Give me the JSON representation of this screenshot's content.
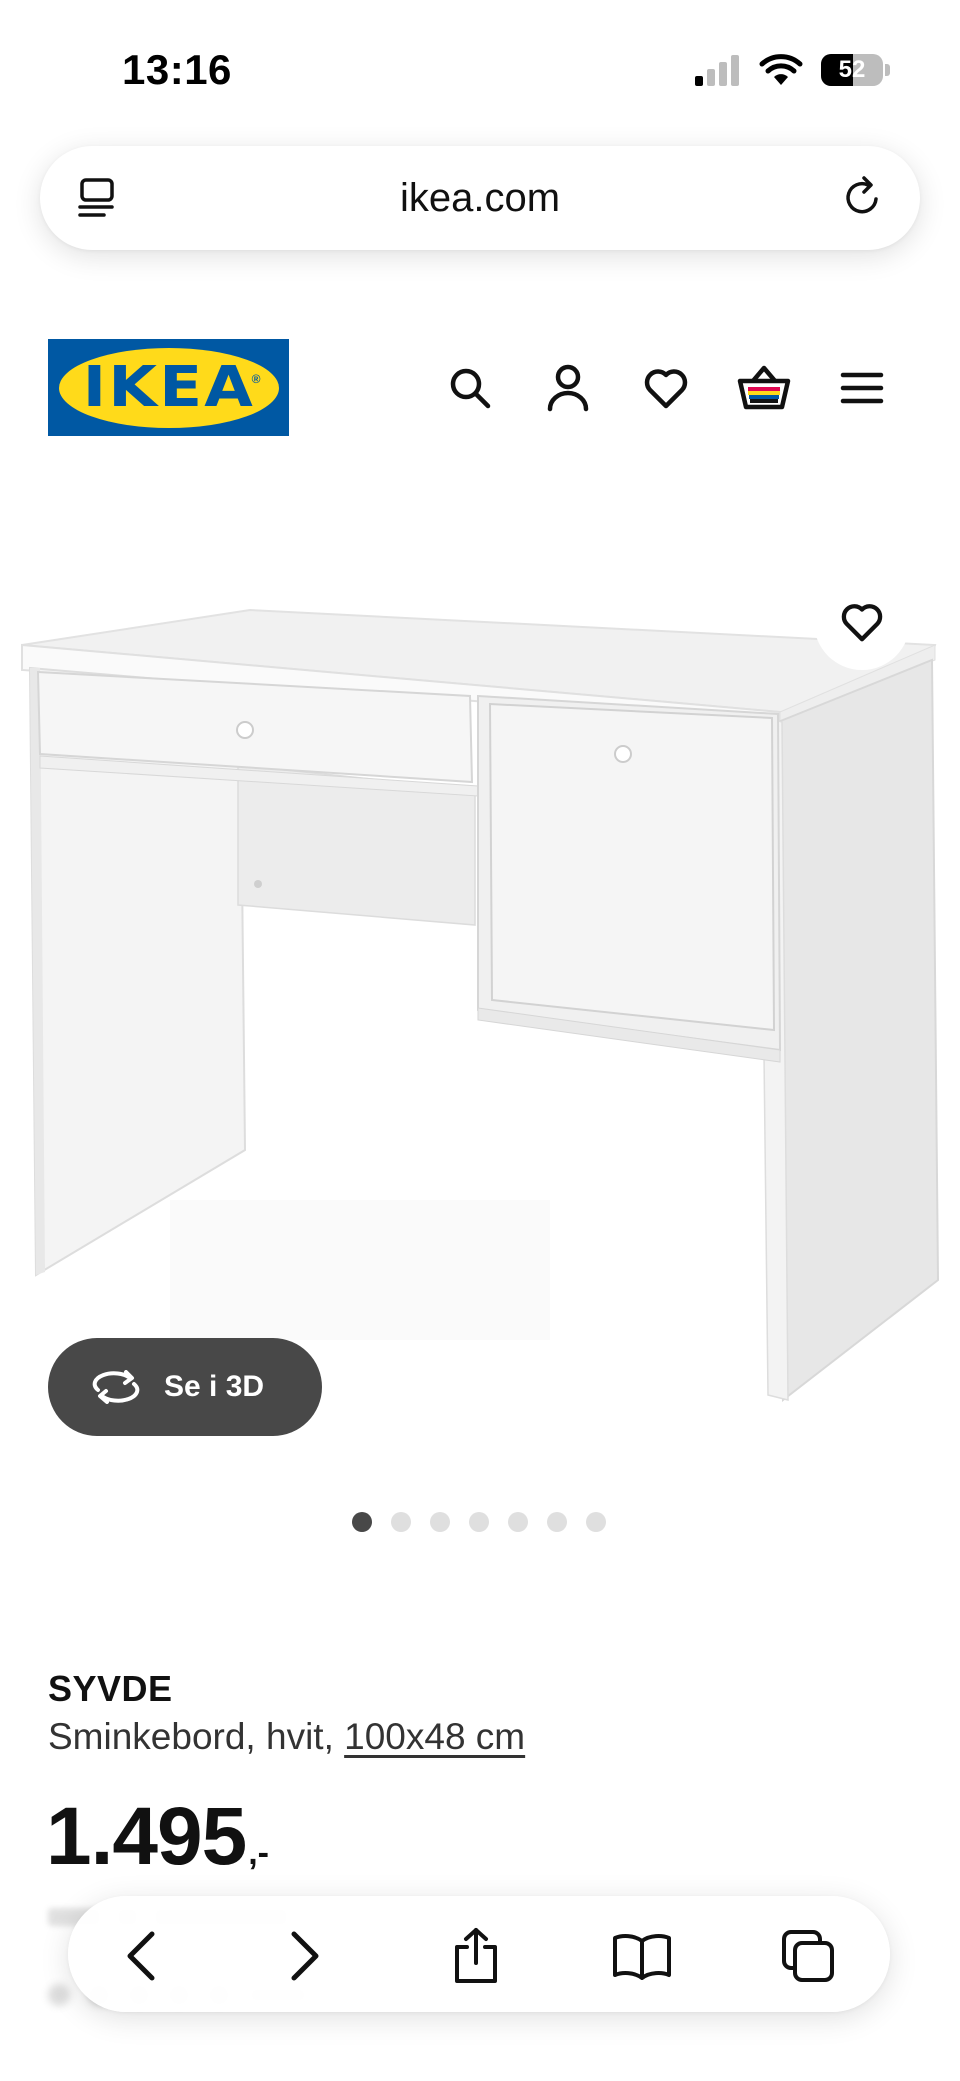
{
  "status_bar": {
    "time": "13:16",
    "battery_level": "52",
    "battery_percent": 52,
    "icons": [
      "cellular-signal-icon",
      "wifi-icon",
      "battery-icon"
    ]
  },
  "browser": {
    "url": "ikea.com",
    "left_icon": "page-menu-icon",
    "right_icon": "reload-icon"
  },
  "header": {
    "logo_text": "IKEA",
    "brand_colors": {
      "blue": "#0058a3",
      "yellow": "#ffda1a"
    },
    "nav_icons": [
      "search-icon",
      "profile-icon",
      "heart-icon",
      "shopping-bag-icon",
      "hamburger-menu-icon"
    ]
  },
  "gallery": {
    "view_3d_label": "Se i 3D",
    "dot_count": 7,
    "active_dot": 0
  },
  "product": {
    "name": "SYVDE",
    "description": "Sminkebord, hvit,",
    "size": "100x48 cm",
    "price_main": "1.495",
    "price_suffix": ",-"
  },
  "toolbar": {
    "icons": [
      "back-icon",
      "forward-icon",
      "share-icon",
      "bookmarks-icon",
      "tabs-icon"
    ]
  }
}
